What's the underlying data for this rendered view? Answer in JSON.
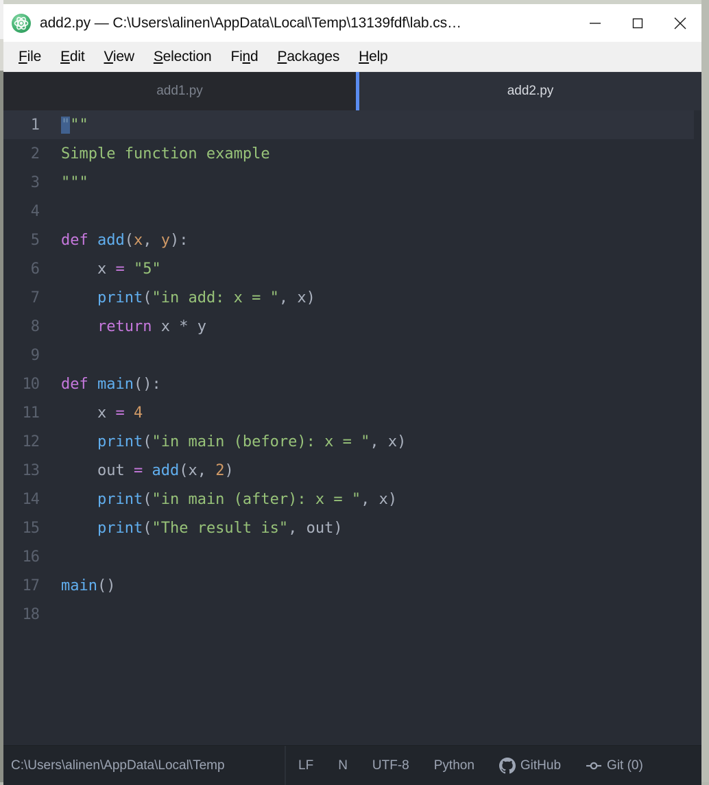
{
  "window": {
    "title": "add2.py — C:\\Users\\alinen\\AppData\\Local\\Temp\\13139fdf\\lab.cs…",
    "app_icon": "atom-logo-icon",
    "controls": {
      "minimize": "minimize-icon",
      "maximize": "maximize-icon",
      "close": "close-icon"
    }
  },
  "menubar": {
    "items": [
      {
        "label": "File",
        "mnemonic_index": 0
      },
      {
        "label": "Edit",
        "mnemonic_index": 0
      },
      {
        "label": "View",
        "mnemonic_index": 0
      },
      {
        "label": "Selection",
        "mnemonic_index": 0
      },
      {
        "label": "Find",
        "mnemonic_index": 2
      },
      {
        "label": "Packages",
        "mnemonic_index": 0
      },
      {
        "label": "Help",
        "mnemonic_index": 0
      }
    ]
  },
  "tabs": [
    {
      "label": "add1.py",
      "active": false
    },
    {
      "label": "add2.py",
      "active": true
    }
  ],
  "editor": {
    "language": "Python",
    "cursor_line": 1,
    "lines": [
      {
        "n": "1",
        "tokens": [
          {
            "t": "\"",
            "c": "tk-sel"
          },
          {
            "t": "\"\"",
            "c": "tk-str"
          }
        ]
      },
      {
        "n": "2",
        "tokens": [
          {
            "t": "Simple function example",
            "c": "tk-str"
          }
        ]
      },
      {
        "n": "3",
        "tokens": [
          {
            "t": "\"\"\"",
            "c": "tk-str"
          }
        ]
      },
      {
        "n": "4",
        "tokens": []
      },
      {
        "n": "5",
        "tokens": [
          {
            "t": "def ",
            "c": "tk-kw"
          },
          {
            "t": "add",
            "c": "tk-fn"
          },
          {
            "t": "(",
            "c": "tk-punc"
          },
          {
            "t": "x",
            "c": "tk-param"
          },
          {
            "t": ", ",
            "c": "tk-punc"
          },
          {
            "t": "y",
            "c": "tk-param"
          },
          {
            "t": "):",
            "c": "tk-punc"
          }
        ]
      },
      {
        "n": "6",
        "tokens": [
          {
            "t": "    x ",
            "c": "tk-var"
          },
          {
            "t": "=",
            "c": "tk-op"
          },
          {
            "t": " ",
            "c": "tk-punc"
          },
          {
            "t": "\"5\"",
            "c": "tk-str"
          }
        ]
      },
      {
        "n": "7",
        "tokens": [
          {
            "t": "    ",
            "c": "tk-punc"
          },
          {
            "t": "print",
            "c": "tk-fn"
          },
          {
            "t": "(",
            "c": "tk-punc"
          },
          {
            "t": "\"in add: x = \"",
            "c": "tk-str"
          },
          {
            "t": ", x)",
            "c": "tk-punc"
          }
        ]
      },
      {
        "n": "8",
        "tokens": [
          {
            "t": "    ",
            "c": "tk-punc"
          },
          {
            "t": "return",
            "c": "tk-kw"
          },
          {
            "t": " x ",
            "c": "tk-var"
          },
          {
            "t": "*",
            "c": "tk-punc"
          },
          {
            "t": " y",
            "c": "tk-var"
          }
        ]
      },
      {
        "n": "9",
        "tokens": []
      },
      {
        "n": "10",
        "tokens": [
          {
            "t": "def ",
            "c": "tk-kw"
          },
          {
            "t": "main",
            "c": "tk-fn"
          },
          {
            "t": "():",
            "c": "tk-punc"
          }
        ]
      },
      {
        "n": "11",
        "tokens": [
          {
            "t": "    x ",
            "c": "tk-var"
          },
          {
            "t": "=",
            "c": "tk-op"
          },
          {
            "t": " ",
            "c": "tk-punc"
          },
          {
            "t": "4",
            "c": "tk-num"
          }
        ]
      },
      {
        "n": "12",
        "tokens": [
          {
            "t": "    ",
            "c": "tk-punc"
          },
          {
            "t": "print",
            "c": "tk-fn"
          },
          {
            "t": "(",
            "c": "tk-punc"
          },
          {
            "t": "\"in main (before): x = \"",
            "c": "tk-str"
          },
          {
            "t": ", x)",
            "c": "tk-punc"
          }
        ]
      },
      {
        "n": "13",
        "tokens": [
          {
            "t": "    out ",
            "c": "tk-var"
          },
          {
            "t": "=",
            "c": "tk-op"
          },
          {
            "t": " ",
            "c": "tk-punc"
          },
          {
            "t": "add",
            "c": "tk-fn"
          },
          {
            "t": "(x, ",
            "c": "tk-punc"
          },
          {
            "t": "2",
            "c": "tk-num"
          },
          {
            "t": ")",
            "c": "tk-punc"
          }
        ]
      },
      {
        "n": "14",
        "tokens": [
          {
            "t": "    ",
            "c": "tk-punc"
          },
          {
            "t": "print",
            "c": "tk-fn"
          },
          {
            "t": "(",
            "c": "tk-punc"
          },
          {
            "t": "\"in main (after): x = \"",
            "c": "tk-str"
          },
          {
            "t": ", x)",
            "c": "tk-punc"
          }
        ]
      },
      {
        "n": "15",
        "tokens": [
          {
            "t": "    ",
            "c": "tk-punc"
          },
          {
            "t": "print",
            "c": "tk-fn"
          },
          {
            "t": "(",
            "c": "tk-punc"
          },
          {
            "t": "\"The result is\"",
            "c": "tk-str"
          },
          {
            "t": ", out)",
            "c": "tk-punc"
          }
        ]
      },
      {
        "n": "16",
        "tokens": []
      },
      {
        "n": "17",
        "tokens": [
          {
            "t": "main",
            "c": "tk-fn"
          },
          {
            "t": "()",
            "c": "tk-punc"
          }
        ]
      },
      {
        "n": "18",
        "tokens": []
      }
    ]
  },
  "statusbar": {
    "path": "C:\\Users\\alinen\\AppData\\Local\\Temp",
    "line_ending": "LF",
    "indent": "N",
    "encoding": "UTF-8",
    "grammar": "Python",
    "github": "GitHub",
    "git": "Git (0)"
  },
  "colors": {
    "accent_blue": "#5a8cf0",
    "editor_bg": "#282c34",
    "statusbar_bg": "#21252b",
    "selection": "#41618f"
  }
}
